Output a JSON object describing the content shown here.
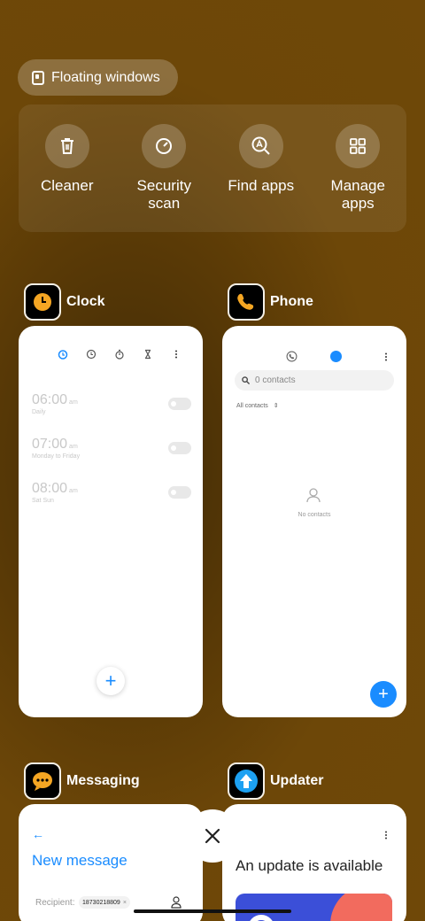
{
  "floating_windows": {
    "label": "Floating windows"
  },
  "tools": [
    {
      "label": "Cleaner",
      "icon": "trash-icon"
    },
    {
      "label": "Security scan",
      "icon": "security-scan-icon"
    },
    {
      "label": "Find apps",
      "icon": "find-apps-icon"
    },
    {
      "label": "Manage apps",
      "icon": "grid-icon"
    }
  ],
  "apps": {
    "clock": {
      "name": "Clock",
      "alarms": [
        {
          "time": "06:00",
          "ampm": "am",
          "repeat": "Daily"
        },
        {
          "time": "07:00",
          "ampm": "am",
          "repeat": "Monday to Friday"
        },
        {
          "time": "08:00",
          "ampm": "am",
          "repeat": "Sat Sun"
        }
      ],
      "add": "+"
    },
    "phone": {
      "name": "Phone",
      "search_placeholder": "0 contacts",
      "filter": "All contacts",
      "empty": "No contacts",
      "add": "+"
    },
    "messaging": {
      "name": "Messaging",
      "back": "←",
      "title": "New message",
      "recipient_label": "Recipient:",
      "recipient_chip": "18730218809",
      "chip_remove": "×"
    },
    "updater": {
      "name": "Updater",
      "title": "An update is available"
    }
  },
  "close": "✕",
  "colors": {
    "accent": "#1a8cff",
    "background": "#6d4708",
    "clock_icon": "#f5a623"
  }
}
